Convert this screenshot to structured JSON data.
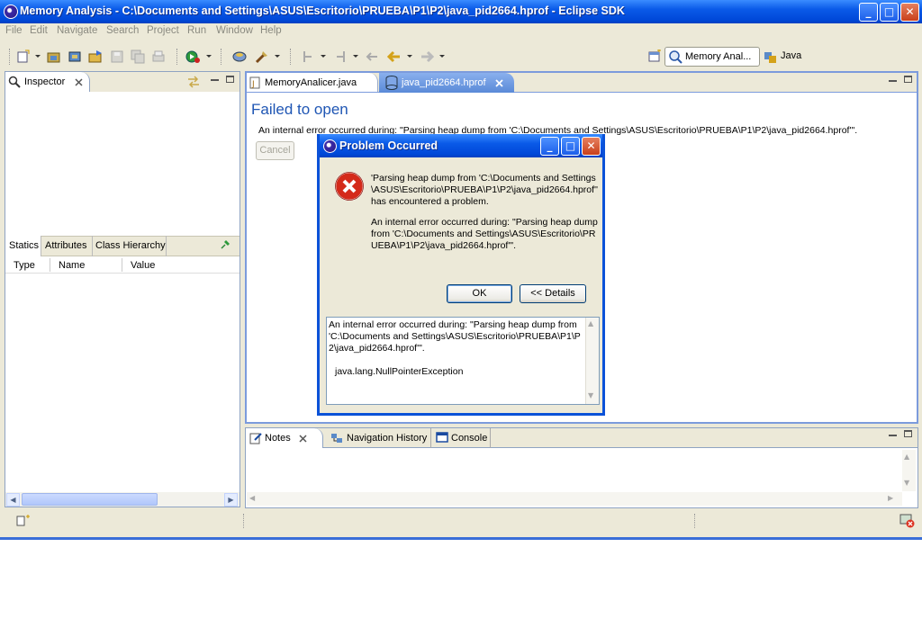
{
  "window": {
    "title": "Memory Analysis - C:\\Documents and Settings\\ASUS\\Escritorio\\PRUEBA\\P1\\P2\\java_pid2664.hprof - Eclipse SDK",
    "min": "_",
    "max": "□",
    "close": "✕"
  },
  "menu": [
    "File",
    "Edit",
    "Navigate",
    "Search",
    "Project",
    "Run",
    "Window",
    "Help"
  ],
  "perspectives": {
    "active": "Memory Anal...",
    "other": "Java"
  },
  "inspector": {
    "tab": "Inspector",
    "subtabs": [
      "Statics",
      "Attributes",
      "Class Hierarchy"
    ],
    "columns": [
      "Type",
      "Name",
      "Value"
    ]
  },
  "editor": {
    "tabs": [
      "MemoryAnalicer.java",
      "java_pid2664.hprof"
    ],
    "heading": "Failed to open",
    "error_line": "An internal error occurred during: \"Parsing heap dump from 'C:\\Documents and Settings\\ASUS\\Escritorio\\PRUEBA\\P1\\P2\\java_pid2664.hprof'\".",
    "cancel": "Cancel"
  },
  "dialog": {
    "title": "Problem Occurred",
    "message1": "'Parsing heap dump from 'C:\\Documents and Settings\\ASUS\\Escritorio\\PRUEBA\\P1\\P2\\java_pid2664.hprof'' has encountered a problem.",
    "message2": "An internal error occurred during: \"Parsing heap dump from 'C:\\Documents and Settings\\ASUS\\Escritorio\\PRUEBA\\P1\\P2\\java_pid2664.hprof'\".",
    "ok": "OK",
    "details": "<< Details",
    "details_text": "An internal error occurred during: \"Parsing heap dump from 'C:\\Documents and Settings\\ASUS\\Escritorio\\PRUEBA\\P1\\P2\\java_pid2664.hprof'\".",
    "exception": "java.lang.NullPointerException"
  },
  "bottom": {
    "tabs": [
      "Notes",
      "Navigation History",
      "Console"
    ]
  }
}
